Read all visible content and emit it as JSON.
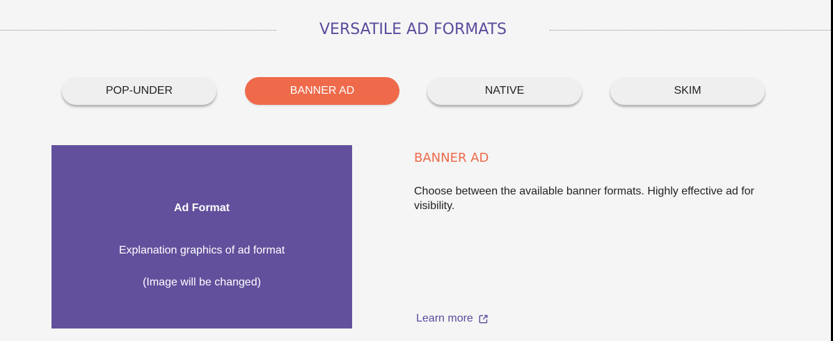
{
  "section": {
    "title": "VERSATILE AD FORMATS"
  },
  "tabs": [
    {
      "label": "POP-UNDER",
      "active": false
    },
    {
      "label": "BANNER AD",
      "active": true
    },
    {
      "label": "NATIVE",
      "active": false
    },
    {
      "label": "SKIM",
      "active": false
    }
  ],
  "panel": {
    "title": "Ad Format",
    "description": "Explanation graphics of ad format",
    "note": "(Image will be changed)"
  },
  "detail": {
    "title": "BANNER AD",
    "text": "Choose between the available banner formats. Highly effective ad for visibility.",
    "link_label": "Learn more",
    "link_icon": "external-link-icon"
  },
  "colors": {
    "accent": "#ee6a4a",
    "brand": "#5b4a9c",
    "panel_bg": "#62509d"
  }
}
